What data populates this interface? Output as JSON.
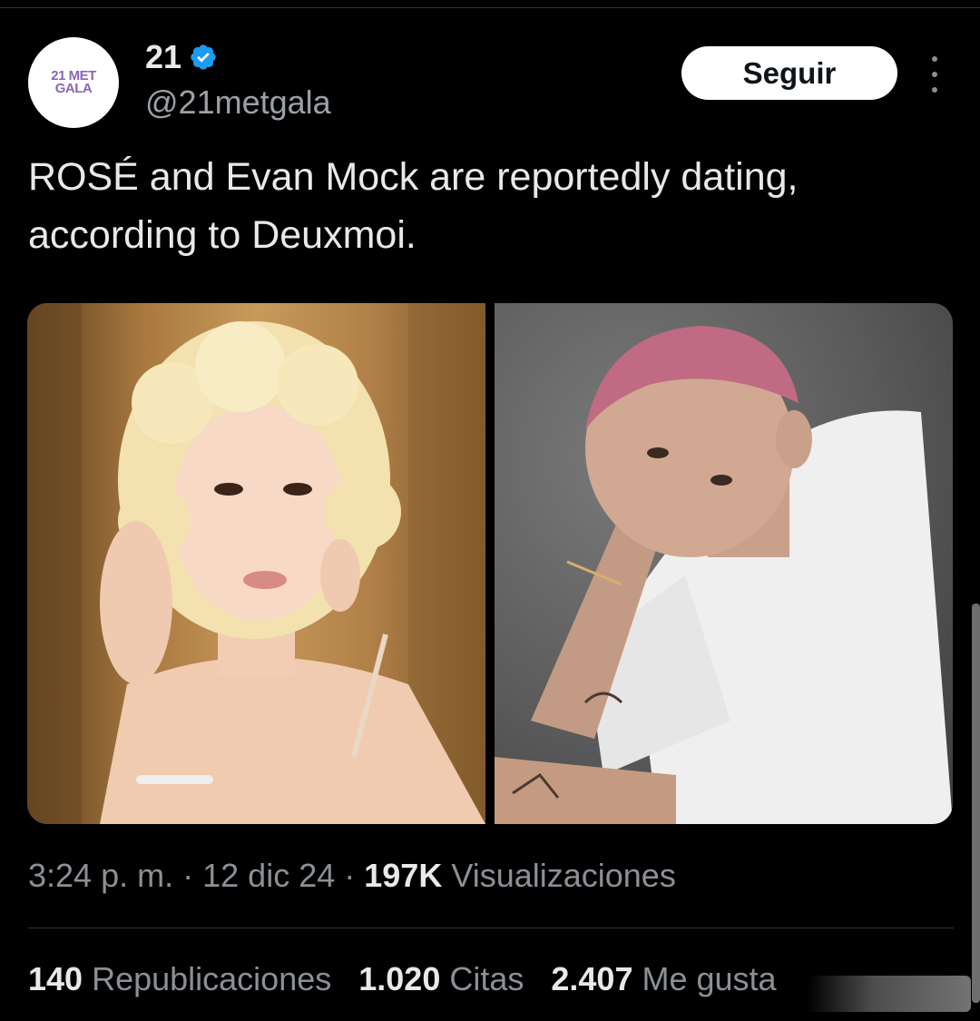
{
  "account": {
    "display_name": "21",
    "handle": "@21metgala",
    "avatar_logo_line1": "21 MET",
    "avatar_logo_line2": "GALA",
    "verified": true
  },
  "actions": {
    "follow_label": "Seguir",
    "more_icon": "more-vertical-icon"
  },
  "tweet": {
    "text": "ROSÉ and Evan Mock are reportedly dating, according to Deuxmoi."
  },
  "media": [
    {
      "name": "photo-rose"
    },
    {
      "name": "photo-evan-mock"
    }
  ],
  "meta": {
    "time": "3:24 p. m.",
    "separator": "·",
    "date": "12 dic 24",
    "views_count": "197K",
    "views_label": "Visualizaciones"
  },
  "stats": {
    "reposts_count": "140",
    "reposts_label": "Republicaciones",
    "quotes_count": "1.020",
    "quotes_label": "Citas",
    "likes_count": "2.407",
    "likes_label": "Me gusta"
  },
  "colors": {
    "background": "#000000",
    "text": "#e7e9ea",
    "muted": "#8b9096",
    "verified": "#1d9bf0",
    "follow_bg": "#ffffff"
  }
}
